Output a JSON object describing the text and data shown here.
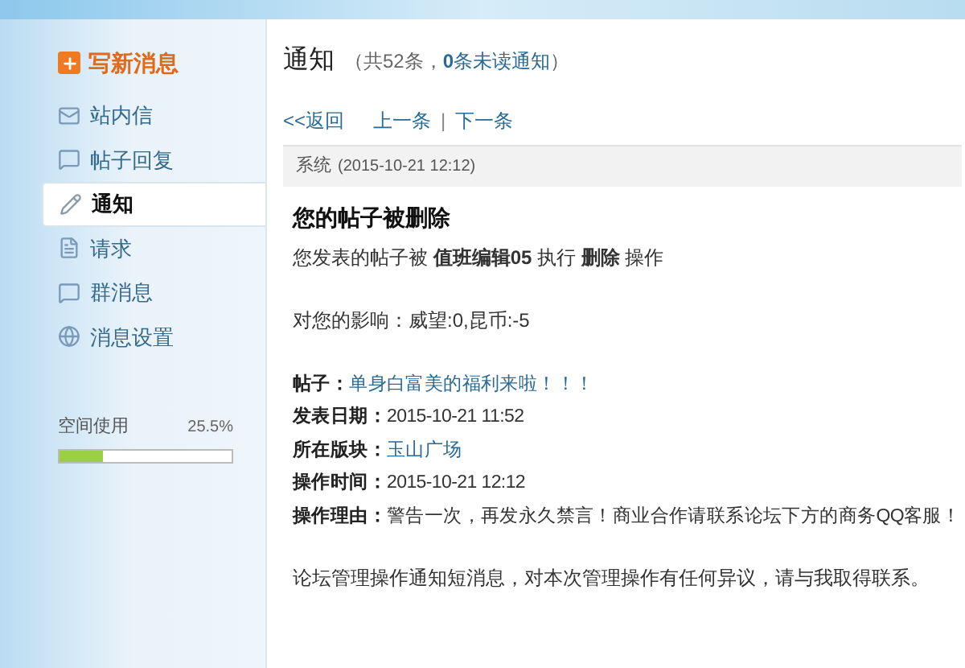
{
  "compose_button": "写新消息",
  "sidebar": {
    "items": [
      {
        "label": "站内信",
        "kind": "mail",
        "selected": false
      },
      {
        "label": "帖子回复",
        "kind": "bubble",
        "selected": false
      },
      {
        "label": "通知",
        "kind": "pencil",
        "selected": true
      },
      {
        "label": "请求",
        "kind": "file",
        "selected": false
      },
      {
        "label": "群消息",
        "kind": "bubble",
        "selected": false
      },
      {
        "label": "消息设置",
        "kind": "globe",
        "selected": false
      }
    ]
  },
  "storage": {
    "label": "空间使用",
    "reading": "25.5%",
    "level": 0.255
  },
  "header": {
    "title": "通知",
    "count_text": "（共52条，",
    "unread_text": "**0**条未读通知",
    "closing": "）"
  },
  "nav": {
    "back": "<<返回",
    "prev": "上一条",
    "separator": "|",
    "next": "下一条"
  },
  "message": {
    "sender": "系统",
    "time": "(2015-10-21 12:12)",
    "subject": "您的帖子被删除",
    "body": "您发表的帖子被 **值班编辑05** 执行 **删除** 操作",
    "impact": "对您的影响：威望:0,昆币:-5",
    "fields": [
      {
        "label": "帖子：",
        "value": "单身白富美的福利来啦！！！",
        "kind": "link"
      },
      {
        "label": "发表日期：",
        "value": "2015-10-21 11:52",
        "kind": "text"
      },
      {
        "label": "所在版块：",
        "value": "玉山广场",
        "kind": "link"
      },
      {
        "label": "操作时间：",
        "value": "2015-10-21 12:12",
        "kind": "text"
      },
      {
        "label": "操作理由：",
        "value": "警告一次，再发永久禁言！商业合作请联系论坛下方的商务QQ客服！",
        "kind": "text"
      }
    ],
    "footer": "论坛管理操作通知短消息，对本次管理操作有任何异议，请与我取得联系。"
  }
}
